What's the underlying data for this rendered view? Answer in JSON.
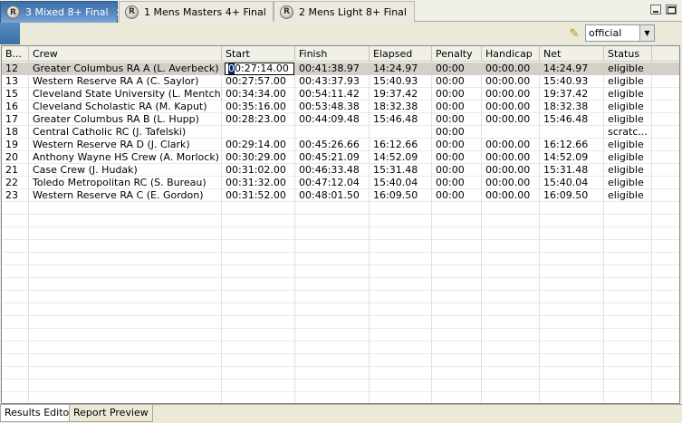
{
  "tabs": [
    {
      "icon": "R",
      "label": "3  Mixed 8+ Final",
      "close": "✕"
    },
    {
      "icon": "R",
      "label": "1  Mens Masters 4+ Final"
    },
    {
      "icon": "R",
      "label": "2  Mens Light 8+ Final"
    }
  ],
  "toolbar": {
    "filter_select": {
      "value": "official",
      "arrow": "▼"
    }
  },
  "table": {
    "columns": [
      "B...",
      "Crew",
      "Start",
      "Finish",
      "Elapsed",
      "Penalty",
      "Handicap",
      "Net",
      "Status"
    ],
    "editing": {
      "row": 0,
      "caret": "0",
      "rest": "0:27:14.00"
    },
    "rows": [
      [
        "12",
        "Greater Columbus RA A  (L. Averbeck)",
        "00:27:14.00",
        "00:41:38.97",
        "14:24.97",
        "00:00",
        "00:00.00",
        "14:24.97",
        "eligible"
      ],
      [
        "13",
        "Western Reserve RA A  (C. Saylor)",
        "00:27:57.00",
        "00:43:37.93",
        "15:40.93",
        "00:00",
        "00:00.00",
        "15:40.93",
        "eligible"
      ],
      [
        "15",
        "Cleveland State University  (L. Mentch)",
        "00:34:34.00",
        "00:54:11.42",
        "19:37.42",
        "00:00",
        "00:00.00",
        "19:37.42",
        "eligible"
      ],
      [
        "16",
        "Cleveland Scholastic RA  (M. Kaput)",
        "00:35:16.00",
        "00:53:48.38",
        "18:32.38",
        "00:00",
        "00:00.00",
        "18:32.38",
        "eligible"
      ],
      [
        "17",
        "Greater Columbus RA B  (L. Hupp)",
        "00:28:23.00",
        "00:44:09.48",
        "15:46.48",
        "00:00",
        "00:00.00",
        "15:46.48",
        "eligible"
      ],
      [
        "18",
        "Central Catholic RC  (J. Tafelski)",
        "",
        "",
        "",
        "00:00",
        "",
        "",
        "scratc..."
      ],
      [
        "19",
        "Western Reserve RA D  (J. Clark)",
        "00:29:14.00",
        "00:45:26.66",
        "16:12.66",
        "00:00",
        "00:00.00",
        "16:12.66",
        "eligible"
      ],
      [
        "20",
        "Anthony Wayne HS Crew  (A. Morlock)",
        "00:30:29.00",
        "00:45:21.09",
        "14:52.09",
        "00:00",
        "00:00.00",
        "14:52.09",
        "eligible"
      ],
      [
        "21",
        "Case Crew  (J. Hudak)",
        "00:31:02.00",
        "00:46:33.48",
        "15:31.48",
        "00:00",
        "00:00.00",
        "15:31.48",
        "eligible"
      ],
      [
        "22",
        "Toledo Metropolitan RC  (S. Bureau)",
        "00:31:32.00",
        "00:47:12.04",
        "15:40.04",
        "00:00",
        "00:00.00",
        "15:40.04",
        "eligible"
      ],
      [
        "23",
        "Western Reserve RA C  (E. Gordon)",
        "00:31:52.00",
        "00:48:01.50",
        "16:09.50",
        "00:00",
        "00:00.00",
        "16:09.50",
        "eligible"
      ]
    ]
  },
  "bottom_tabs": [
    "Results Editor",
    "Report Preview"
  ]
}
